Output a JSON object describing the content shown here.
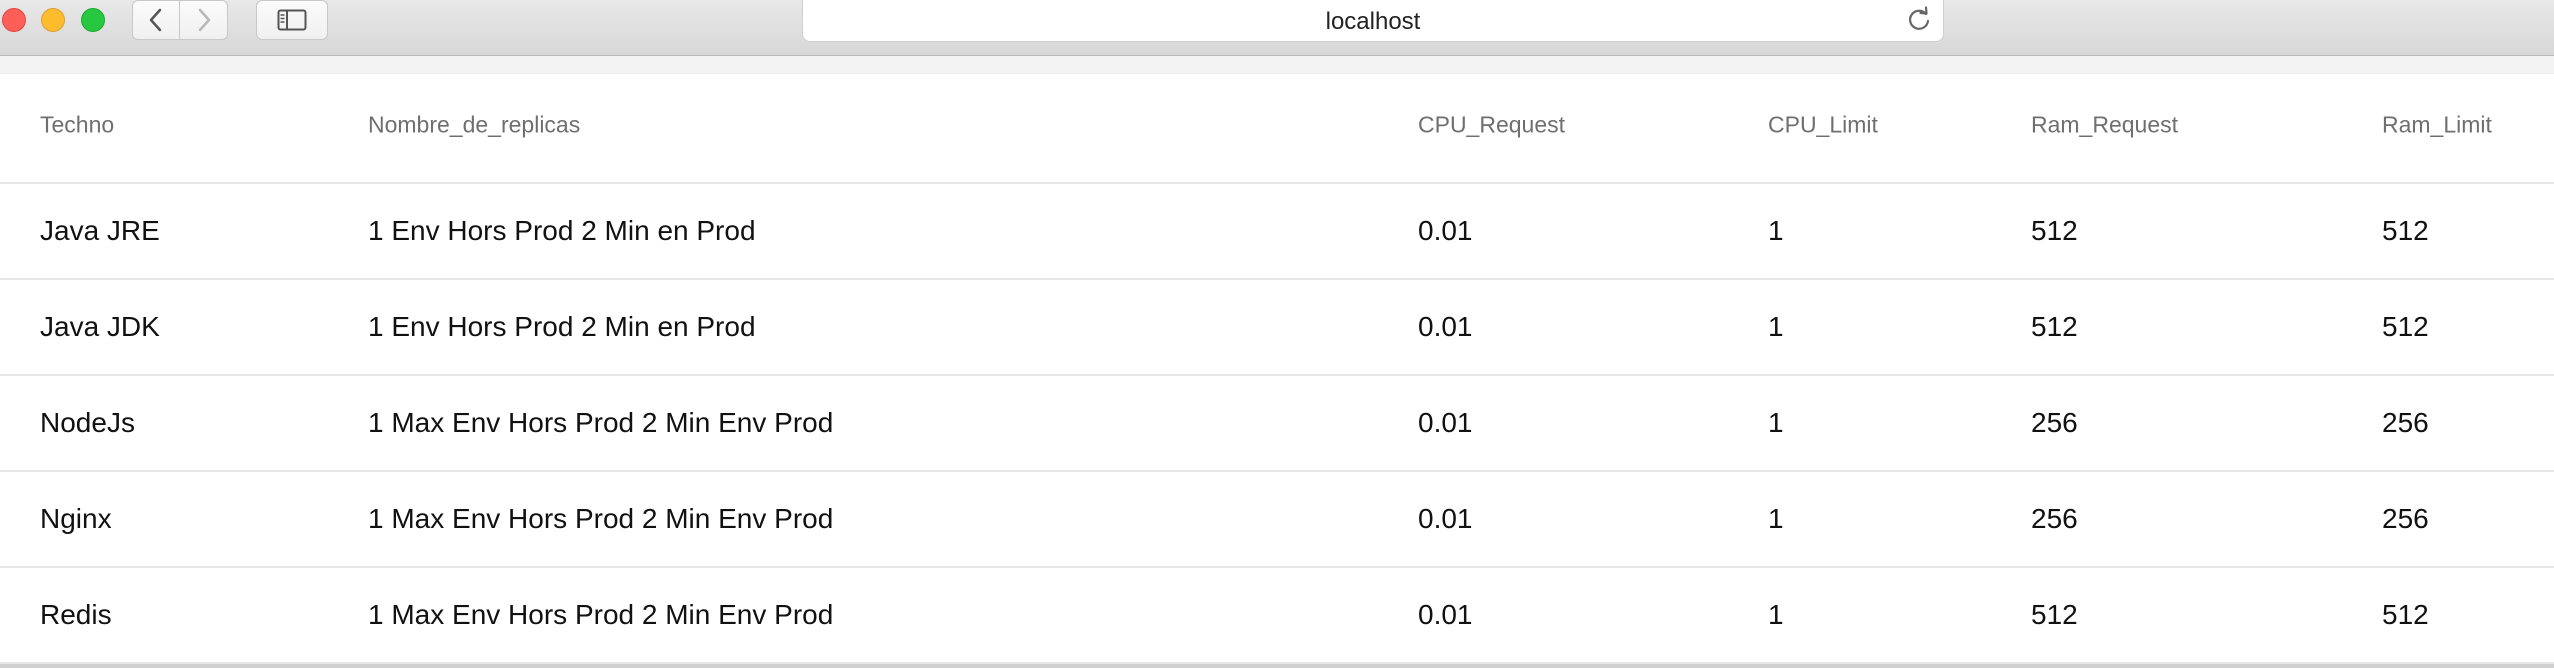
{
  "browser": {
    "url": "localhost"
  },
  "table": {
    "columns": [
      "Techno",
      "Nombre_de_replicas",
      "CPU_Request",
      "CPU_Limit",
      "Ram_Request",
      "Ram_Limit"
    ],
    "rows": [
      [
        "Java JRE",
        "1 Env Hors Prod 2 Min en Prod",
        "0.01",
        "1",
        "512",
        "512"
      ],
      [
        "Java JDK",
        "1 Env Hors Prod 2 Min en Prod",
        "0.01",
        "1",
        "512",
        "512"
      ],
      [
        "NodeJs",
        "1 Max Env Hors Prod 2 Min Env Prod",
        "0.01",
        "1",
        "256",
        "256"
      ],
      [
        "Nginx",
        "1 Max Env Hors Prod 2 Min Env Prod",
        "0.01",
        "1",
        "256",
        "256"
      ],
      [
        "Redis",
        "1 Max Env Hors Prod 2 Min Env Prod",
        "0.01",
        "1",
        "512",
        "512"
      ]
    ]
  },
  "icons": {
    "close": "close-window-icon",
    "minimize": "minimize-window-icon",
    "maximize": "maximize-window-icon",
    "back": "chevron-left-icon",
    "forward": "chevron-right-icon",
    "sidebar": "sidebar-icon",
    "reload": "reload-icon"
  },
  "colors": {
    "close": "#fc5f57",
    "minimize": "#fdbc2e",
    "maximize": "#27c840",
    "header_text": "#6f6f6f",
    "row_divider": "#e6e6e6"
  }
}
